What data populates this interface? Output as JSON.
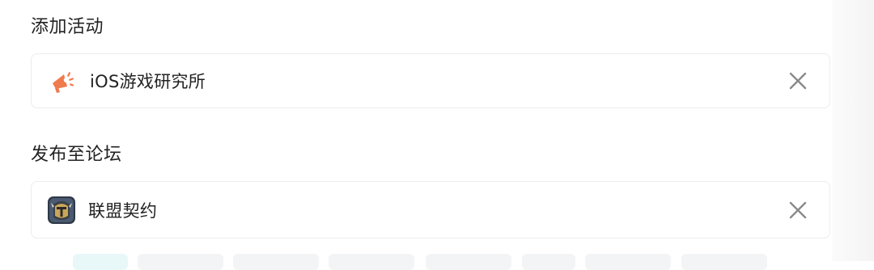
{
  "activity_section": {
    "title": "添加活动",
    "item": {
      "label": "iOS游戏研究所",
      "icon": "megaphone-icon",
      "icon_color": "#f07b4d"
    }
  },
  "forum_section": {
    "title": "发布至论坛",
    "item": {
      "label": "联盟契约",
      "icon": "forum-avatar-knight-icon"
    }
  },
  "colors": {
    "text": "#222222",
    "border": "#ececec",
    "close_icon": "#8a8a8a",
    "chip_bg": "#f3f4f5",
    "chip_active_bg": "#e8f7f8"
  }
}
